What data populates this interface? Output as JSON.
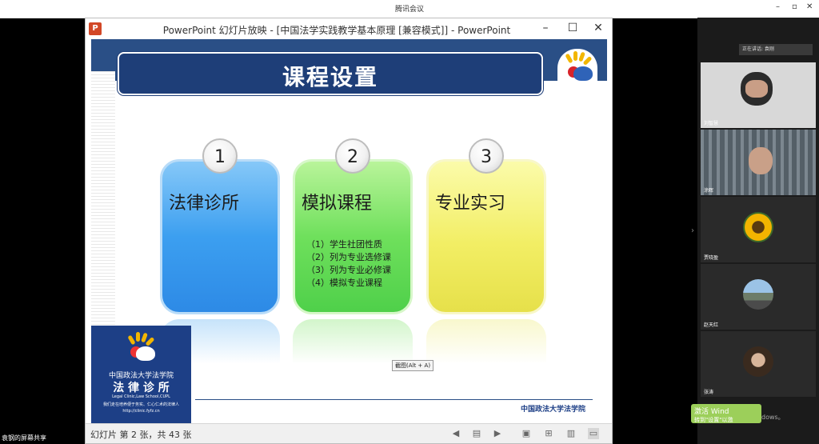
{
  "meeting": {
    "app_title": "腾讯会议",
    "min": "–",
    "restore": "▫",
    "close": "✕"
  },
  "ppt": {
    "window_title": "PowerPoint 幻灯片放映 - [中国法学实践教学基本原理 [兼容模式]] - PowerPoint",
    "min": "–",
    "max": "☐",
    "close": "✕",
    "status": "幻灯片 第 2 张，共 43 张"
  },
  "slide": {
    "title": "课程设置",
    "cards": [
      {
        "num": "1",
        "title": "法律诊所",
        "items": []
      },
      {
        "num": "2",
        "title": "模拟课程",
        "items": [
          "（1）学生社团性质",
          "（2）列为专业选修课",
          "（3）列为专业必修课",
          "（4）模拟专业课程"
        ]
      },
      {
        "num": "3",
        "title": "专业实习",
        "items": []
      }
    ],
    "tooltip": "截图(Alt + A)",
    "logo_block": {
      "line1": "中国政法大学法学院",
      "line2": "法 律 诊 所",
      "line3": "Legal Clinic,Law School,CUPL",
      "line4": "我们走在培养便于务实、仁心仁术的法律人",
      "line5": "http://clinic.fyfz.cn"
    },
    "footer": "中国政法大学法学院"
  },
  "participants": {
    "speaker_label": "正在讲话: 袁刚",
    "tiles": [
      {
        "name": "刘智慧"
      },
      {
        "name": "涂晖"
      },
      {
        "name": "贾晓盈"
      },
      {
        "name": "赵天红"
      },
      {
        "name": "张涛"
      }
    ]
  },
  "share_label": "袁钢的屏幕共享",
  "watermark": {
    "text": "激活 Wind",
    "text2": "转到\"设置\"以激",
    "tail": "dows。"
  },
  "colors": {
    "blue": "#3c9ff0",
    "green": "#6fe05c",
    "yellow": "#f2ee64",
    "navy": "#1e3e78"
  }
}
